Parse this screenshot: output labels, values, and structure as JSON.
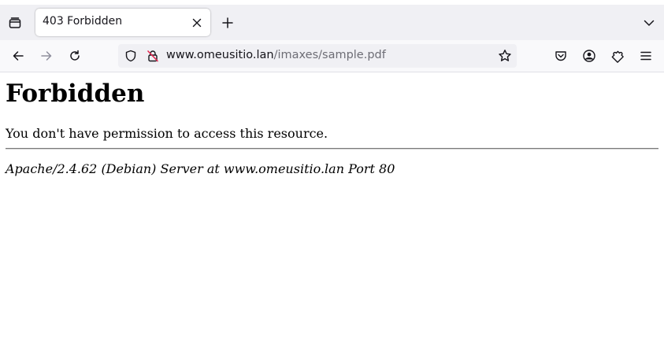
{
  "browser": {
    "tab": {
      "title": "403 Forbidden"
    },
    "urlbar": {
      "domain_prefix": "www.",
      "domain": "omeusitio.lan",
      "path": "/imaxes/sample.pdf"
    },
    "icons": {
      "tab_overview": "folder-icon",
      "new_tab": "plus-icon",
      "tab_list": "chevron-down-icon",
      "back": "arrow-left-icon",
      "forward": "arrow-right-icon",
      "reload": "reload-icon",
      "tracking": "shield-icon",
      "insecure": "insecure-lock-icon",
      "bookmark": "star-icon",
      "pocket": "pocket-icon",
      "account": "account-icon",
      "extensions": "puzzle-icon",
      "menu": "hamburger-menu-icon"
    }
  },
  "page": {
    "heading": "Forbidden",
    "message": "You don't have permission to access this resource.",
    "server_signature": "Apache/2.4.62 (Debian) Server at www.omeusitio.lan Port 80"
  }
}
